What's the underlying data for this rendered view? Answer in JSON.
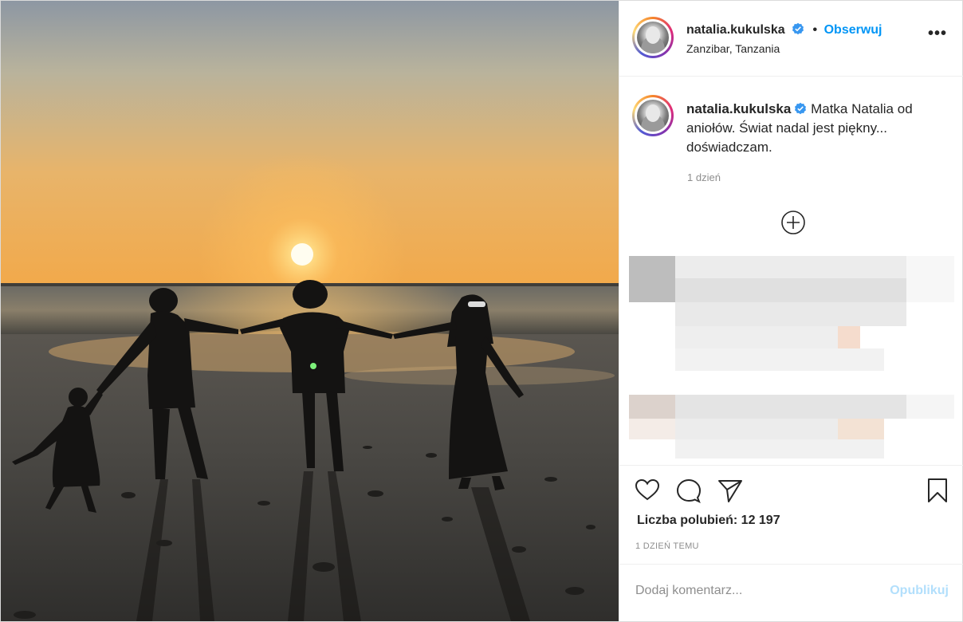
{
  "post": {
    "author": {
      "username": "natalia.kukulska",
      "verified": true,
      "follow_label": "Obserwuj",
      "separator": "•",
      "location": "Zanzibar, Tanzania",
      "avatar_icon": "profile-avatar"
    },
    "caption": {
      "username": "natalia.kukulska",
      "text": "Matka Natalia od aniołów. Świat nadal jest piękny... doświadczam.",
      "time": "1 dzień"
    },
    "more_icon": "more-options-icon",
    "load_more_icon": "plus-circle-icon",
    "actions": {
      "like_icon": "heart-icon",
      "comment_icon": "comment-icon",
      "share_icon": "send-icon",
      "save_icon": "bookmark-icon",
      "likes_label": "Liczba polubień: 12 197",
      "timestamp": "1 DZIEŃ TEMU"
    },
    "comment": {
      "placeholder": "Dodaj komentarz...",
      "publish_label": "Opublikuj"
    },
    "colors": {
      "accent": "#0095f6",
      "publish_disabled": "#b2dffc",
      "text": "#262626",
      "muted": "#8e8e8e"
    }
  }
}
